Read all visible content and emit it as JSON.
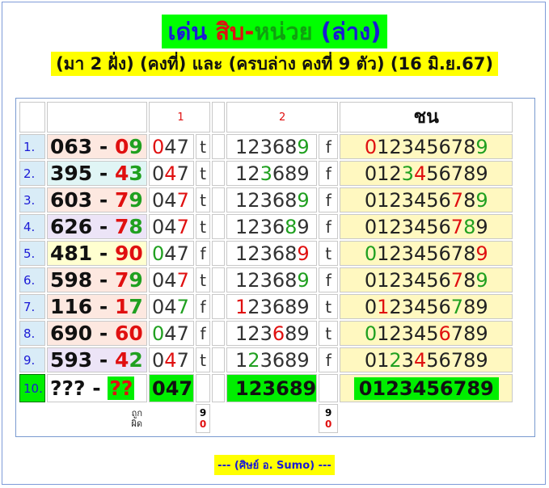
{
  "title": {
    "part1": "เด่น",
    "part2": "สิบ",
    "dash": "-",
    "part3": "หน่วย",
    "part4": "(ล่าง)"
  },
  "subtitle": "(มา 2 ฝั่ง) (คงที่) และ (ครบล่าง คงที่ 9 ตัว) (16 มิ.ย.67)",
  "headers": {
    "group1": "1",
    "group2": "2",
    "chon": "ชน"
  },
  "rows": [
    {
      "idx": "1.",
      "a": "063",
      "sep": " - ",
      "b": "09",
      "g1": "047",
      "tf1": "t",
      "g2": "123689",
      "tf2": "f",
      "chon": "0123456789"
    },
    {
      "idx": "2.",
      "a": "395",
      "sep": " - ",
      "b": "43",
      "g1": "047",
      "tf1": "t",
      "g2": "123689",
      "tf2": "f",
      "chon": "0123456789"
    },
    {
      "idx": "3.",
      "a": "603",
      "sep": " - ",
      "b": "79",
      "g1": "047",
      "tf1": "t",
      "g2": "123689",
      "tf2": "f",
      "chon": "0123456789"
    },
    {
      "idx": "4.",
      "a": "626",
      "sep": " - ",
      "b": "78",
      "g1": "047",
      "tf1": "t",
      "g2": "123689",
      "tf2": "f",
      "chon": "0123456789"
    },
    {
      "idx": "5.",
      "a": "481",
      "sep": " - ",
      "b": "90",
      "g1": "047",
      "tf1": "f",
      "g2": "123689",
      "tf2": "t",
      "chon": "0123456789"
    },
    {
      "idx": "6.",
      "a": "598",
      "sep": " - ",
      "b": "79",
      "g1": "047",
      "tf1": "t",
      "g2": "123689",
      "tf2": "f",
      "chon": "0123456789"
    },
    {
      "idx": "7.",
      "a": "116",
      "sep": " - ",
      "b": "17",
      "g1": "047",
      "tf1": "f",
      "g2": "123689",
      "tf2": "t",
      "chon": "0123456789"
    },
    {
      "idx": "8.",
      "a": "690",
      "sep": " - ",
      "b": "60",
      "g1": "047",
      "tf1": "f",
      "g2": "123689",
      "tf2": "t",
      "chon": "0123456789"
    },
    {
      "idx": "9.",
      "a": "593",
      "sep": " - ",
      "b": "42",
      "g1": "047",
      "tf1": "t",
      "g2": "123689",
      "tf2": "f",
      "chon": "0123456789"
    },
    {
      "idx": "10.",
      "a": "???",
      "sep": " - ",
      "b": "??",
      "g1": "047",
      "tf1": "",
      "g2": "123689",
      "tf2": "",
      "chon": "0123456789"
    }
  ],
  "footer": {
    "label_right": "ถูก",
    "label_wrong": "ผิด",
    "g1_right": "9",
    "g1_wrong": "0",
    "g2_right": "9",
    "g2_wrong": "0"
  },
  "signature": "--- (ศิษย์  อ. Sumo) ---",
  "colors": {
    "hit_red": "#e01010",
    "hit_green": "#20a020",
    "title_bg": "#00ff00",
    "subtitle_bg": "#ffff00",
    "chon_bg": "#fff8c0"
  }
}
